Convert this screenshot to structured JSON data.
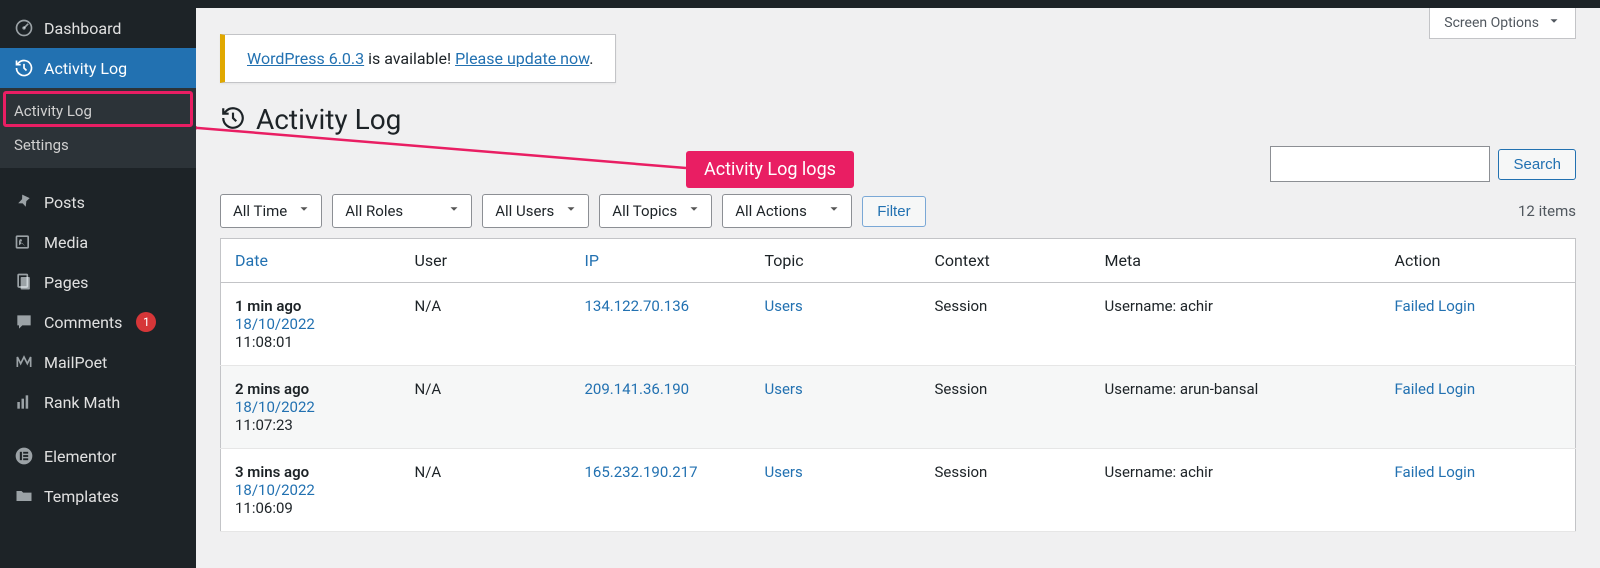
{
  "screen_options": "Screen Options",
  "notice": {
    "prefix_link": "WordPress 6.0.3",
    "mid": " is available! ",
    "suffix_link": "Please update now",
    "end": "."
  },
  "page_title": "Activity Log",
  "sidebar": {
    "items": [
      {
        "label": "Dashboard"
      },
      {
        "label": "Activity Log"
      },
      {
        "label": "Posts"
      },
      {
        "label": "Media"
      },
      {
        "label": "Pages"
      },
      {
        "label": "Comments",
        "badge": "1"
      },
      {
        "label": "MailPoet"
      },
      {
        "label": "Rank Math"
      },
      {
        "label": "Elementor"
      },
      {
        "label": "Templates"
      }
    ],
    "sub": [
      {
        "label": "Activity Log"
      },
      {
        "label": "Settings"
      }
    ]
  },
  "search": {
    "button": "Search"
  },
  "filters": {
    "time": "All Time",
    "roles": "All Roles",
    "users": "All Users",
    "topics": "All Topics",
    "actions": "All Actions",
    "filter_btn": "Filter",
    "count": "12 items"
  },
  "table": {
    "headers": {
      "date": "Date",
      "user": "User",
      "ip": "IP",
      "topic": "Topic",
      "context": "Context",
      "meta": "Meta",
      "action": "Action"
    },
    "rows": [
      {
        "ago": "1 min ago",
        "date": "18/10/2022",
        "time": "11:08:01",
        "user": "N/A",
        "ip": "134.122.70.136",
        "topic": "Users",
        "context": "Session",
        "meta": "Username: achir",
        "action": "Failed Login"
      },
      {
        "ago": "2 mins ago",
        "date": "18/10/2022",
        "time": "11:07:23",
        "user": "N/A",
        "ip": "209.141.36.190",
        "topic": "Users",
        "context": "Session",
        "meta": "Username: arun-bansal",
        "action": "Failed Login"
      },
      {
        "ago": "3 mins ago",
        "date": "18/10/2022",
        "time": "11:06:09",
        "user": "N/A",
        "ip": "165.232.190.217",
        "topic": "Users",
        "context": "Session",
        "meta": "Username: achir",
        "action": "Failed Login"
      }
    ]
  },
  "annotation": {
    "label": "Activity Log logs"
  }
}
